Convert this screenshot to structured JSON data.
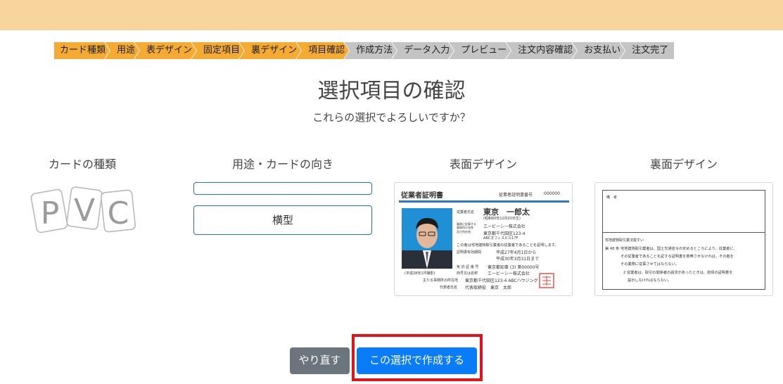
{
  "colors": {
    "topbar": "#f9d59e",
    "step_active": "#f5ab33",
    "step_inactive": "#c4c4c4",
    "primary": "#0a7cf7",
    "secondary": "#6c757d",
    "highlight": "#e0141e"
  },
  "steps": [
    {
      "label": "カード種類",
      "active": true
    },
    {
      "label": "用途",
      "active": true
    },
    {
      "label": "表デザイン",
      "active": true
    },
    {
      "label": "固定項目",
      "active": true
    },
    {
      "label": "裏デザイン",
      "active": true
    },
    {
      "label": "項目確認",
      "active": true
    },
    {
      "label": "作成方法",
      "active": false
    },
    {
      "label": "データ入力",
      "active": false
    },
    {
      "label": "プレビュー",
      "active": false
    },
    {
      "label": "注文内容確認",
      "active": false
    },
    {
      "label": "お支払い",
      "active": false
    },
    {
      "label": "注文完了",
      "active": false
    }
  ],
  "page": {
    "title": "選択項目の確認",
    "subtitle": "これらの選択でよろしいですか？"
  },
  "columns": {
    "card_type": {
      "label": "カードの種類",
      "logo_letters": [
        "P",
        "V",
        "C"
      ]
    },
    "usage": {
      "label": "用途・カードの向き",
      "purpose_value": "",
      "orientation_value": "横型"
    },
    "front": {
      "label": "表面デザイン",
      "title": "従業者証明書",
      "number_label": "従業者証明書番号",
      "number": "000000",
      "name_label": "従業者氏名",
      "name": "東京　一郎太",
      "birth": "(昭和60年12月20日生)",
      "org_label_1": "業務に従事する",
      "org_label_2": "事務所の名称",
      "org_name": "エービーシー株式会社",
      "org_addr_label": "及び所在地",
      "org_addr_1": "東京都千代田区123-4",
      "org_addr_2": "ABCオフィスビル17F",
      "statement": "この者は宅地建物取引業者の従業者であることを証明します。",
      "valid_label": "証明書有効期間",
      "valid_from": "平成27年4月1日から",
      "valid_to": "平成30年3月31日まで",
      "license_label": "免 許 証 番 号",
      "license": "東京都知事 (3) 第00000号",
      "company_label": "商号又は名称",
      "company": "エービーシー株式会社",
      "main_office_label": "主たる事務所の所在地",
      "main_office": "東京都千代田区123-4 ABCハウジング",
      "rep_label": "代表者氏名",
      "rep": "代表取締役　東京　太郎",
      "photo_date": "(平成28年1月撮影)"
    },
    "back": {
      "label": "裏面デザイン",
      "remarks_label": "備　考",
      "law_title": "宅地建物取引業法抜すい",
      "clause_1_num": "第 48 条",
      "clause_1_line_1": "宅地建物取引業者は、国土交通省令の定めるところにより、従業者に、",
      "clause_1_line_2": "その従業者であることを証する証明書を携帯させなければ、その者を",
      "clause_1_line_3": "その業務に従事させてはならない。",
      "clause_2_line_1": "2 従業者は、取引の関係者の請求があったときは、前項の証明書を",
      "clause_2_line_2": "提示しなければならない。"
    }
  },
  "buttons": {
    "redo": "やり直す",
    "create": "この選択で作成する"
  }
}
